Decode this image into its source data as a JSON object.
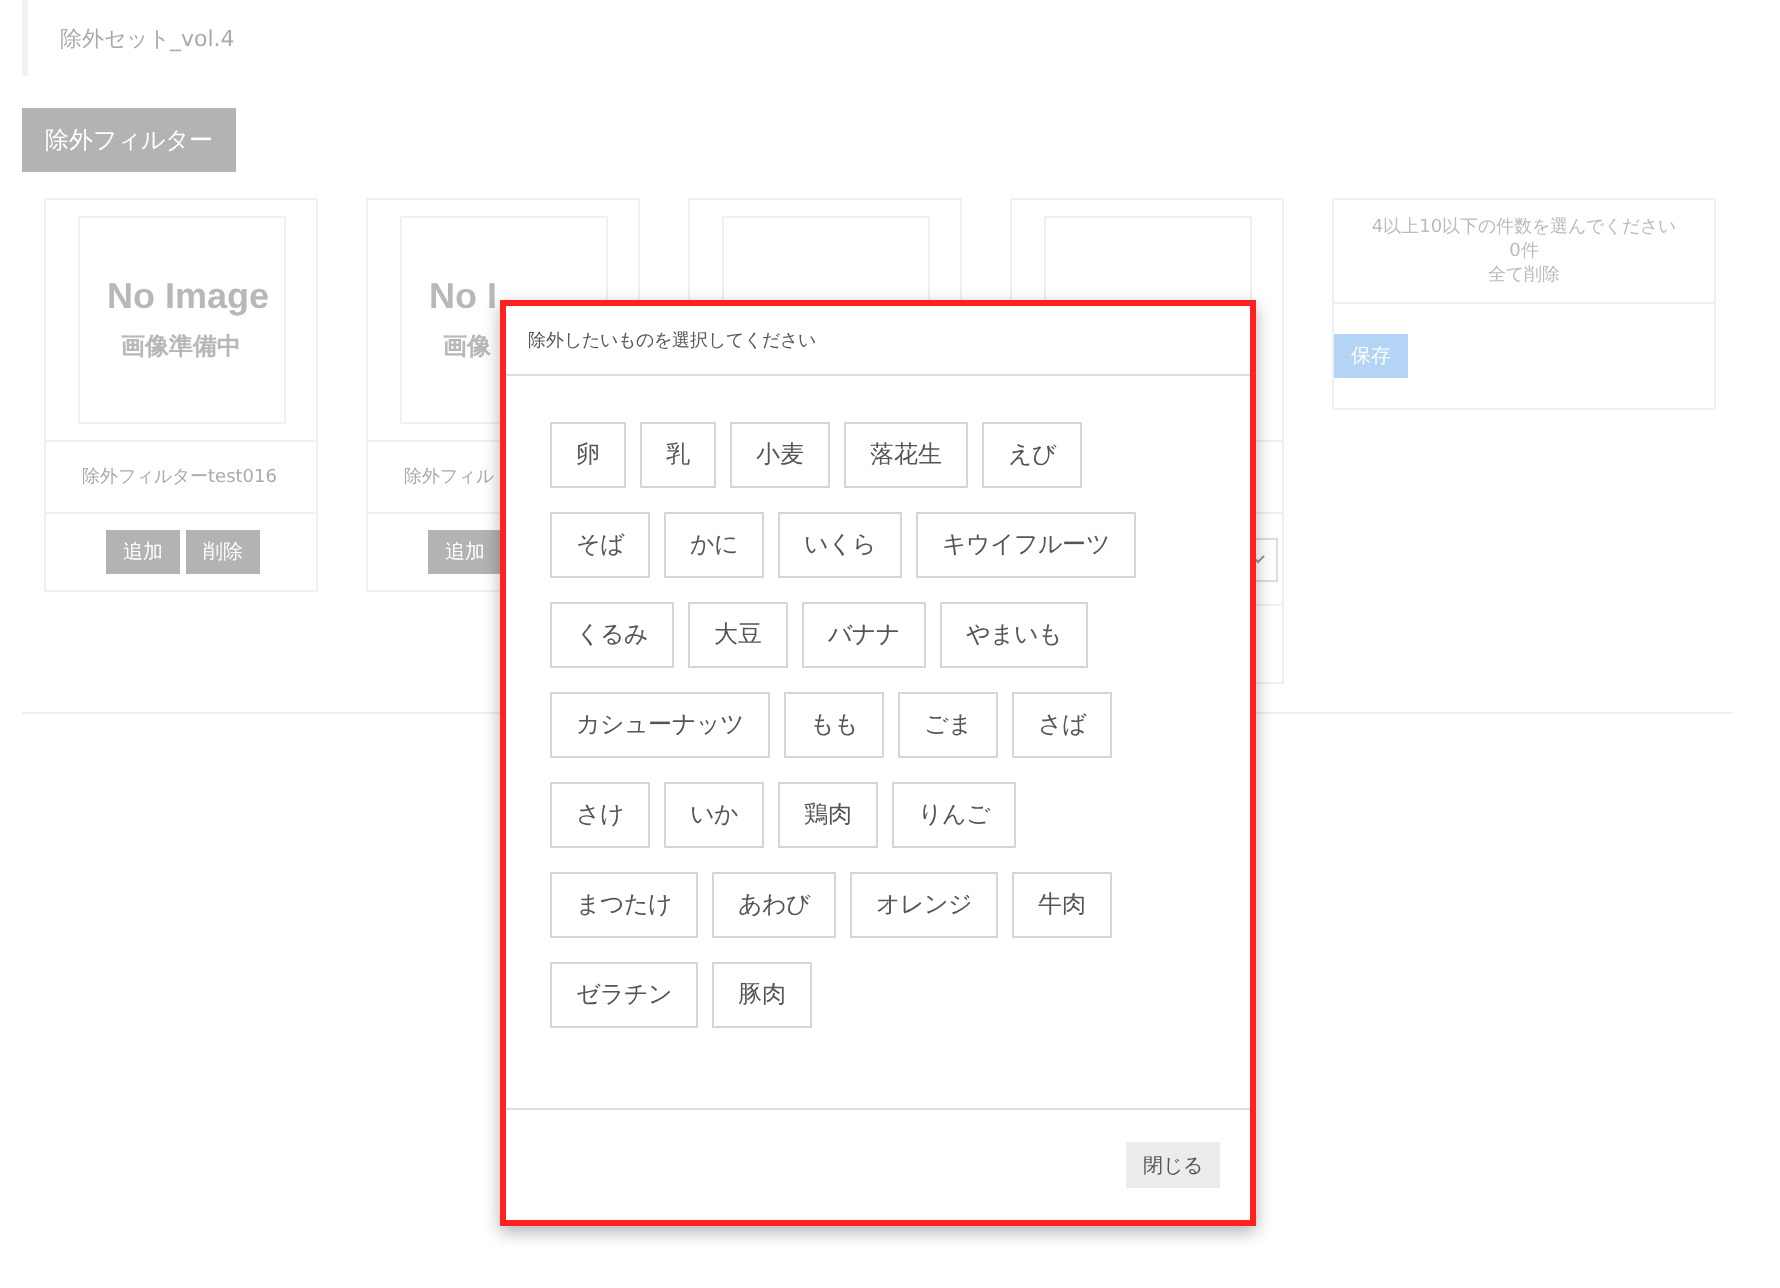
{
  "header": {
    "title": "除外セット_vol.4"
  },
  "filter_button": "除外フィルター",
  "cards": [
    {
      "kind": "plain",
      "image_text": [
        "No Image",
        "画像準備中"
      ],
      "name": "除外フィルターtest016",
      "buttons": [
        "追加",
        "削除"
      ]
    },
    {
      "kind": "plain",
      "image_text": [
        "No I",
        "画像"
      ],
      "name": "除外フィル",
      "buttons": [
        "追加"
      ]
    },
    {
      "kind": "plain"
    },
    {
      "kind": "select"
    }
  ],
  "summary": {
    "message": "4以上10以下の件数を選んでください",
    "count": "0件",
    "clear_all": "全て削除",
    "save": "保存"
  },
  "modal": {
    "title": "除外したいものを選択してください",
    "options": [
      "卵",
      "乳",
      "小麦",
      "落花生",
      "えび",
      "そば",
      "かに",
      "いくら",
      "キウイフルーツ",
      "くるみ",
      "大豆",
      "バナナ",
      "やまいも",
      "カシューナッツ",
      "もも",
      "ごま",
      "さば",
      "さけ",
      "いか",
      "鶏肉",
      "りんご",
      "まつたけ",
      "あわび",
      "オレンジ",
      "牛肉",
      "ゼラチン",
      "豚肉"
    ],
    "close": "閉じる"
  }
}
